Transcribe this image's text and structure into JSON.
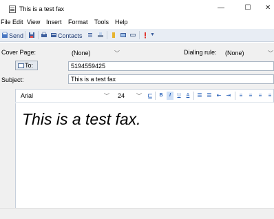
{
  "window": {
    "title": "This is a test fax",
    "minimize": "—",
    "maximize": "☐",
    "close": "✕"
  },
  "menu": [
    "File",
    "Edit",
    "View",
    "Insert",
    "Format",
    "Tools",
    "Help"
  ],
  "toolbar": {
    "send_label": "Send",
    "contacts_label": "Contacts"
  },
  "header": {
    "cover_page_label": "Cover Page:",
    "cover_page_value": "(None)",
    "dialing_rule_label": "Dialing rule:",
    "dialing_rule_value": "(None)",
    "to_label": "To:",
    "to_value": "5194559425",
    "subject_label": "Subject:",
    "subject_value": "This is a test fax"
  },
  "format": {
    "font_name": "Arial",
    "font_size": "24"
  },
  "body": {
    "text": "This is a test fax."
  },
  "colors": {
    "toolbar_bg": "#e8edf4",
    "panel_bg": "#f0f0f0",
    "accent": "#1f5bb5"
  }
}
